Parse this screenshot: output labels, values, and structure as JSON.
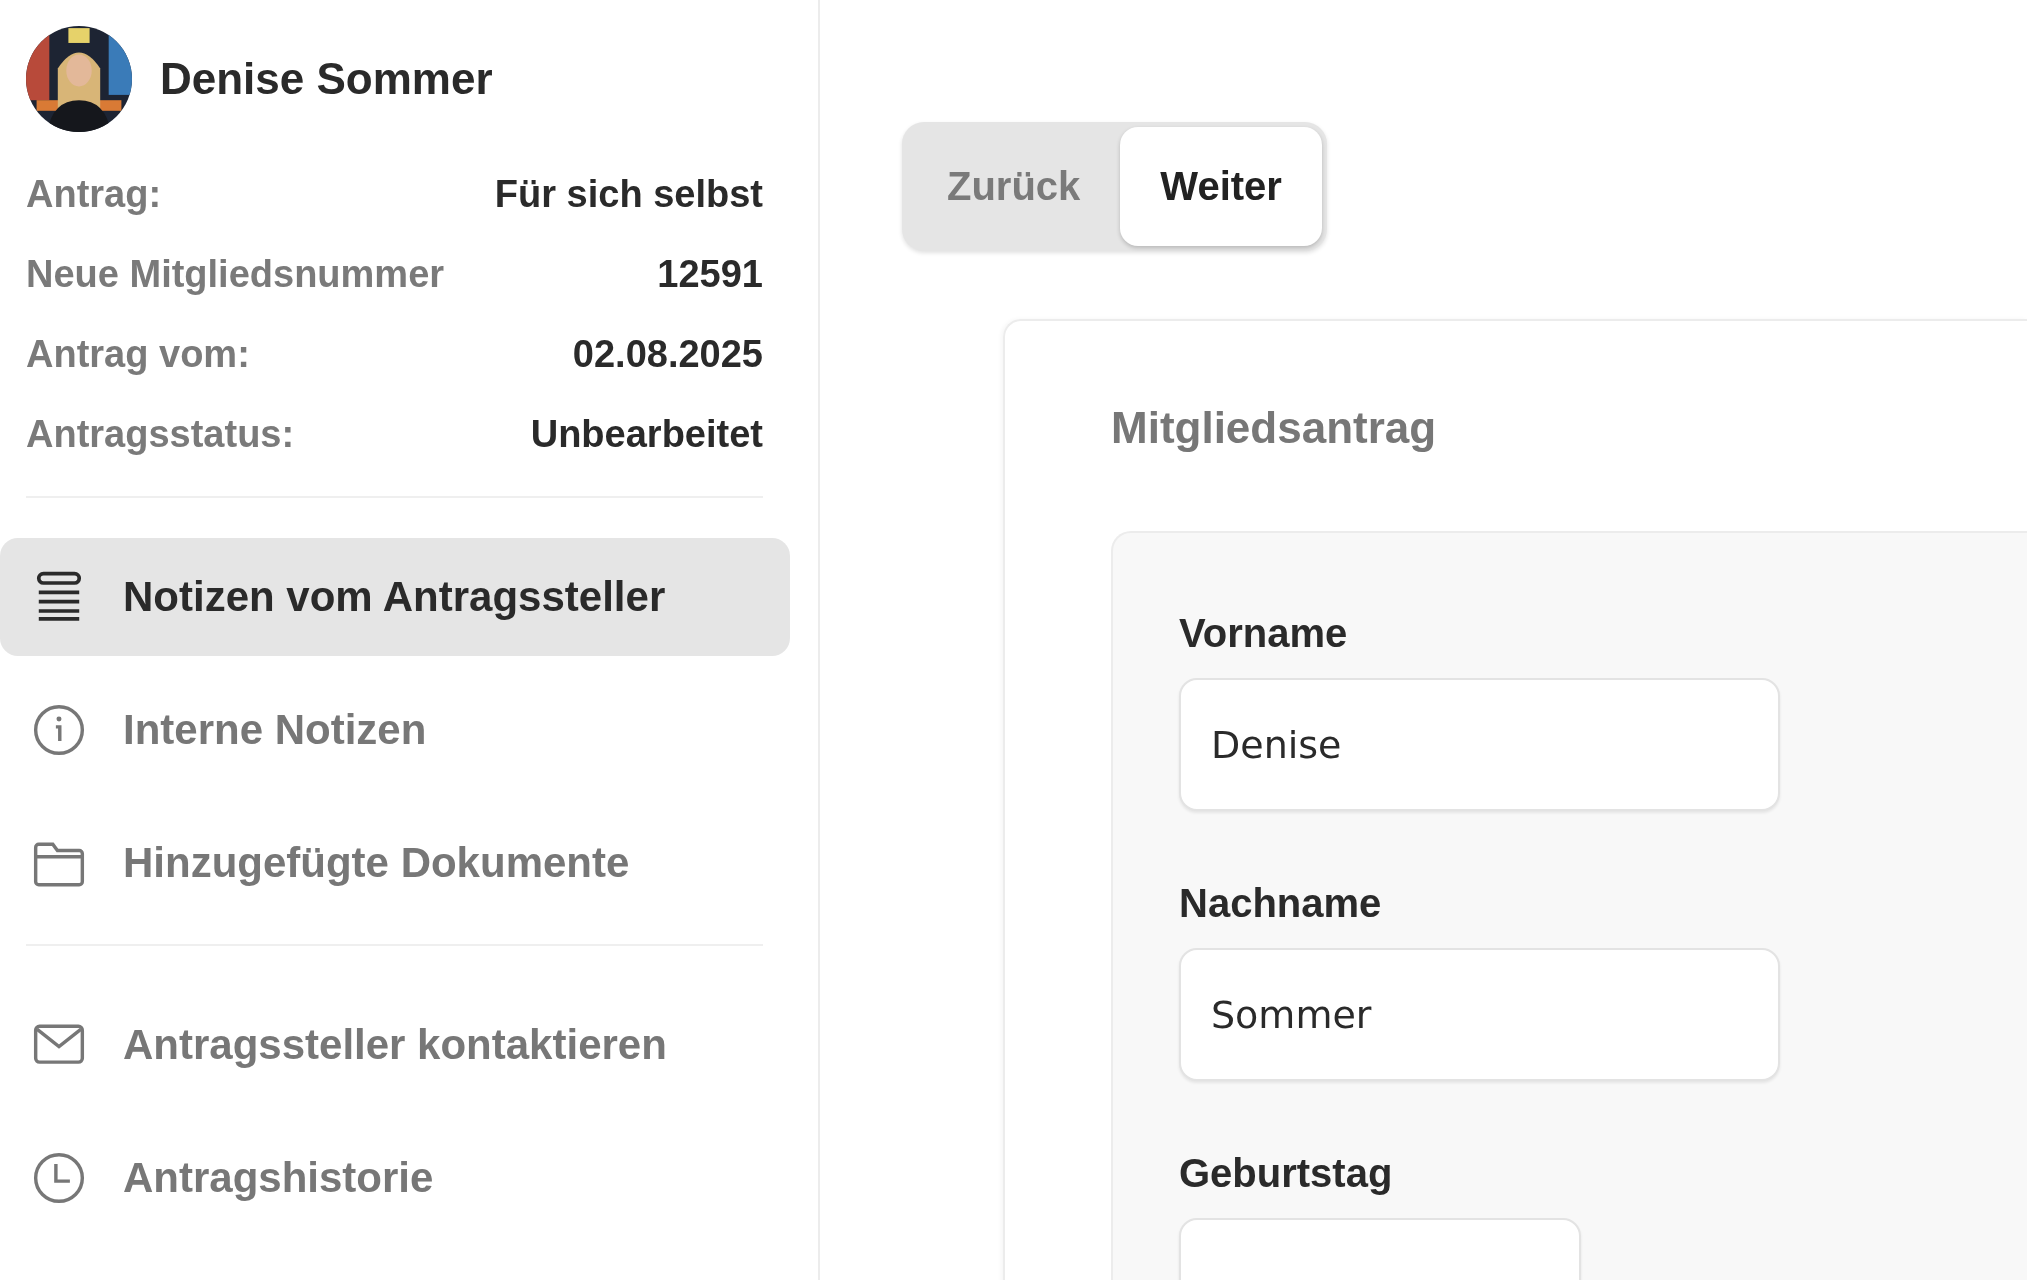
{
  "applicant": {
    "name": "Denise Sommer"
  },
  "info": [
    {
      "label": "Antrag:",
      "value": "Für sich selbst"
    },
    {
      "label": "Neue Mitgliedsnummer",
      "value": "12591"
    },
    {
      "label": "Antrag vom:",
      "value": "02.08.2025"
    },
    {
      "label": "Antragsstatus:",
      "value": "Unbearbeitet"
    }
  ],
  "nav_groups": [
    [
      {
        "label": "Notizen vom Antragssteller",
        "selected": true
      },
      {
        "label": "Interne Notizen",
        "selected": false
      },
      {
        "label": "Hinzugefügte Dokumente",
        "selected": false
      }
    ],
    [
      {
        "label": "Antragssteller kontaktieren",
        "selected": false
      },
      {
        "label": "Antragshistorie",
        "selected": false
      }
    ]
  ],
  "stepper": [
    {
      "label": "Zurück",
      "selected": false
    },
    {
      "label": "Weiter",
      "selected": true
    }
  ],
  "form": {
    "title": "Mitgliedsantrag",
    "fields": [
      {
        "label": "Vorname",
        "value": "Denise",
        "kind": "text"
      },
      {
        "label": "Nachname",
        "value": "Sommer",
        "kind": "text"
      },
      {
        "label": "Geburtstag",
        "kind": "date"
      }
    ]
  }
}
